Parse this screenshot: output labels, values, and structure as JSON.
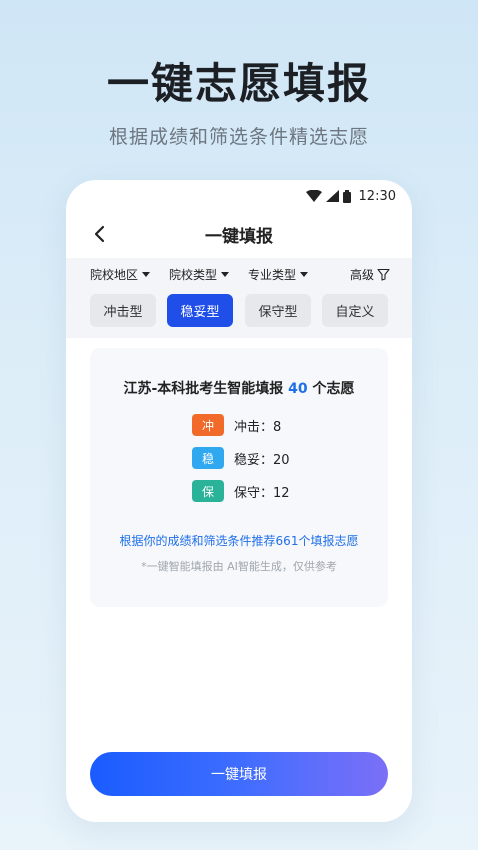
{
  "promo": {
    "title": "一键志愿填报",
    "subtitle": "根据成绩和筛选条件精选志愿"
  },
  "statusbar": {
    "time": "12:30"
  },
  "nav": {
    "title": "一键填报"
  },
  "filters": {
    "dropdowns": [
      "院校地区",
      "院校类型",
      "专业类型"
    ],
    "advanced": "高级"
  },
  "tabs": [
    {
      "label": "冲击型",
      "active": false
    },
    {
      "label": "稳妥型",
      "active": true
    },
    {
      "label": "保守型",
      "active": false
    },
    {
      "label": "自定义",
      "active": false
    }
  ],
  "card": {
    "title_prefix": "江苏-本科批考生智能填报 ",
    "count": "40",
    "title_suffix": " 个志愿",
    "stats": [
      {
        "badge": "冲",
        "label": "冲击：8",
        "color": "#f26a2a"
      },
      {
        "badge": "稳",
        "label": "稳妥：20",
        "color": "#2fa8f0"
      },
      {
        "badge": "保",
        "label": "保守：12",
        "color": "#2bb39a"
      }
    ],
    "recommend": "根据你的成绩和筛选条件推荐661个填报志愿",
    "disclaimer": "*一键智能填报由 AI智能生成，仅供参考"
  },
  "cta": {
    "label": "一键填报"
  }
}
